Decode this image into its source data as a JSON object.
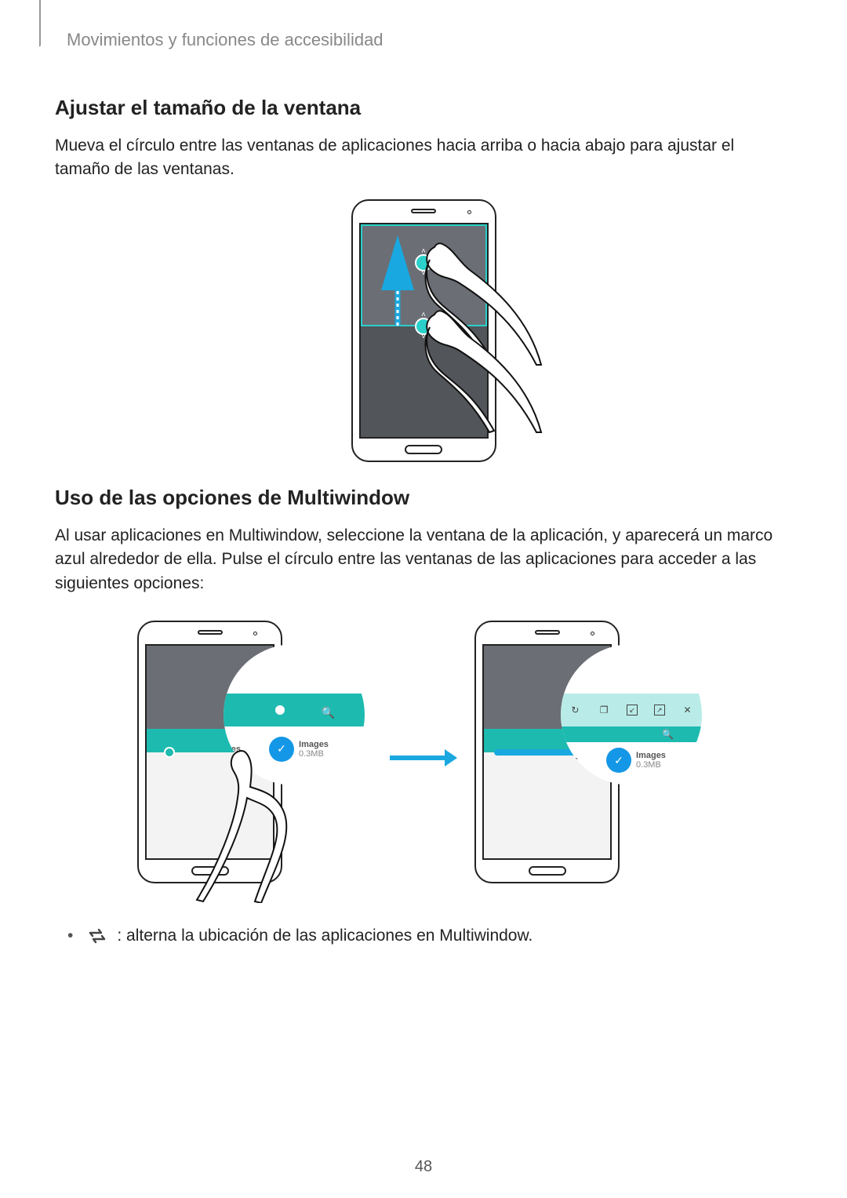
{
  "breadcrumb": "Movimientos y funciones de accesibilidad",
  "section1": {
    "heading": "Ajustar el tamaño de la ventana",
    "body": "Mueva el círculo entre las ventanas de aplicaciones hacia arriba o hacia abajo para ajustar el tamaño de las ventanas."
  },
  "section2": {
    "heading": "Uso de las opciones de Multiwindow",
    "body": "Al usar aplicaciones en Multiwindow, seleccione la ventana de la aplicación, y aparecerá un marco azul alrededor de ella. Pulse el círculo entre las ventanas de las aplicaciones para acceder a las siguientes opciones:"
  },
  "bubble_labels": {
    "files": "files",
    "images": "Images",
    "size": "0.3MB"
  },
  "bullet": {
    "text": ": alterna la ubicación de las aplicaciones en Multiwindow."
  },
  "page_number": "48"
}
